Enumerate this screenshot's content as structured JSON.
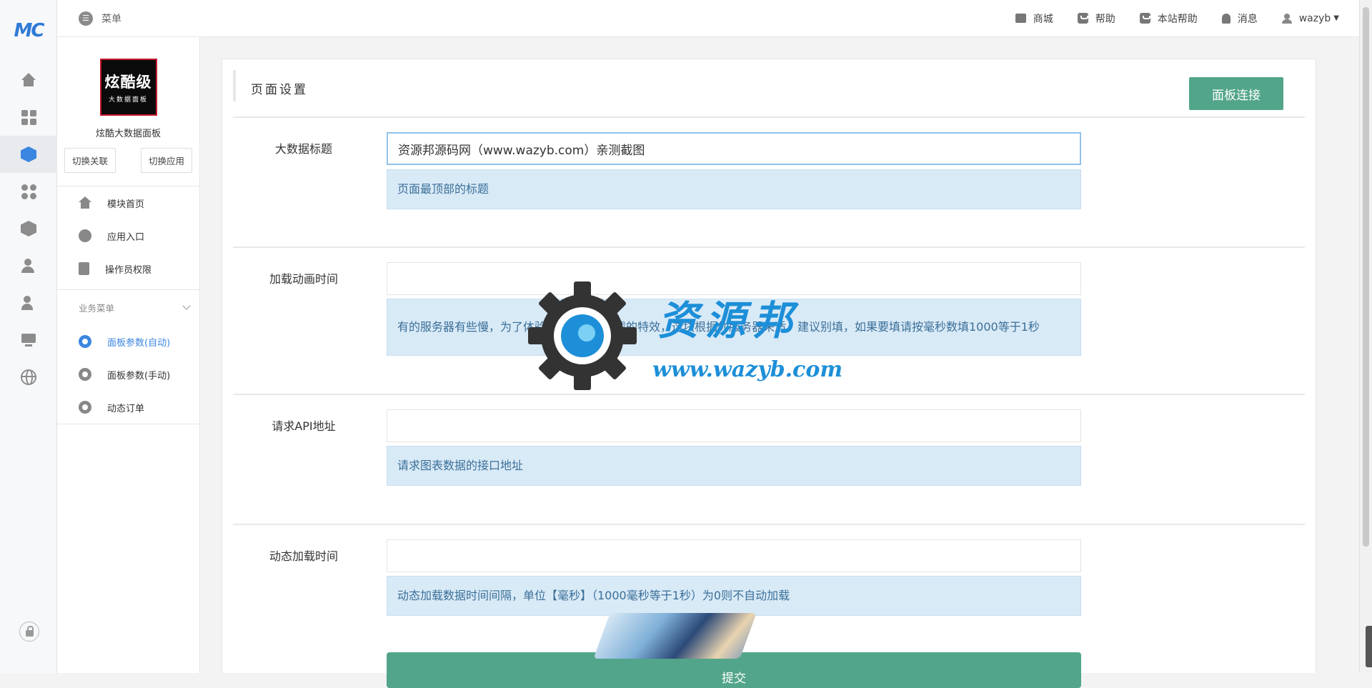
{
  "header": {
    "menu_label": "菜单",
    "nav": [
      {
        "label": "商城",
        "icon": "store-icon"
      },
      {
        "label": "帮助",
        "icon": "help-bag-icon"
      },
      {
        "label": "本站帮助",
        "icon": "site-help-bag-icon"
      },
      {
        "label": "消息",
        "icon": "bell-icon"
      }
    ],
    "user": "wazyb"
  },
  "rail": {
    "logo": "MC",
    "icons": [
      "home-icon",
      "apps-grid-icon",
      "cube-icon",
      "modules-icon",
      "package-settings-icon",
      "users-icon",
      "user-lock-icon",
      "monitor-icon",
      "globe-icon",
      "lock-icon"
    ],
    "active_index": 2
  },
  "sidebar": {
    "brand_big": "炫酷级",
    "brand_small": "大数据面板",
    "brand_name": "炫酷大数据面板",
    "switch_link": "切换关联",
    "switch_app": "切换应用",
    "items": [
      {
        "label": "模块首页",
        "icon": "home-icon"
      },
      {
        "label": "应用入口",
        "icon": "chat-icon"
      },
      {
        "label": "操作员权限",
        "icon": "document-icon"
      }
    ],
    "group_title": "业务菜单",
    "group_items": [
      {
        "label": "面板参数(自动)",
        "icon": "gear-icon",
        "active": true
      },
      {
        "label": "面板参数(手动)",
        "icon": "gear-icon"
      },
      {
        "label": "动态订单",
        "icon": "gear-icon"
      }
    ]
  },
  "panel": {
    "title": "页面设置",
    "connect_button": "面板连接",
    "fields": [
      {
        "label": "大数据标题",
        "value": "资源邦源码网（www.wazyb.com）亲测截图",
        "help": "页面最顶部的标题"
      },
      {
        "label": "加载动画时间",
        "value": "",
        "help": "有的服务器有些慢，为了体验好一般有个加载的特效，这块根据你服务器来适，建议别填，如果要填请按毫秒数填1000等于1秒"
      },
      {
        "label": "请求API地址",
        "value": "",
        "help": "请求图表数据的接口地址"
      },
      {
        "label": "动态加载时间",
        "value": "",
        "help": "动态加载数据时间间隔，单位【毫秒】（1000毫秒等于1秒）为0则不自动加载"
      }
    ],
    "submit_button": "提交"
  },
  "watermark": {
    "text": "资源邦",
    "url": "www.wazyb.com"
  }
}
